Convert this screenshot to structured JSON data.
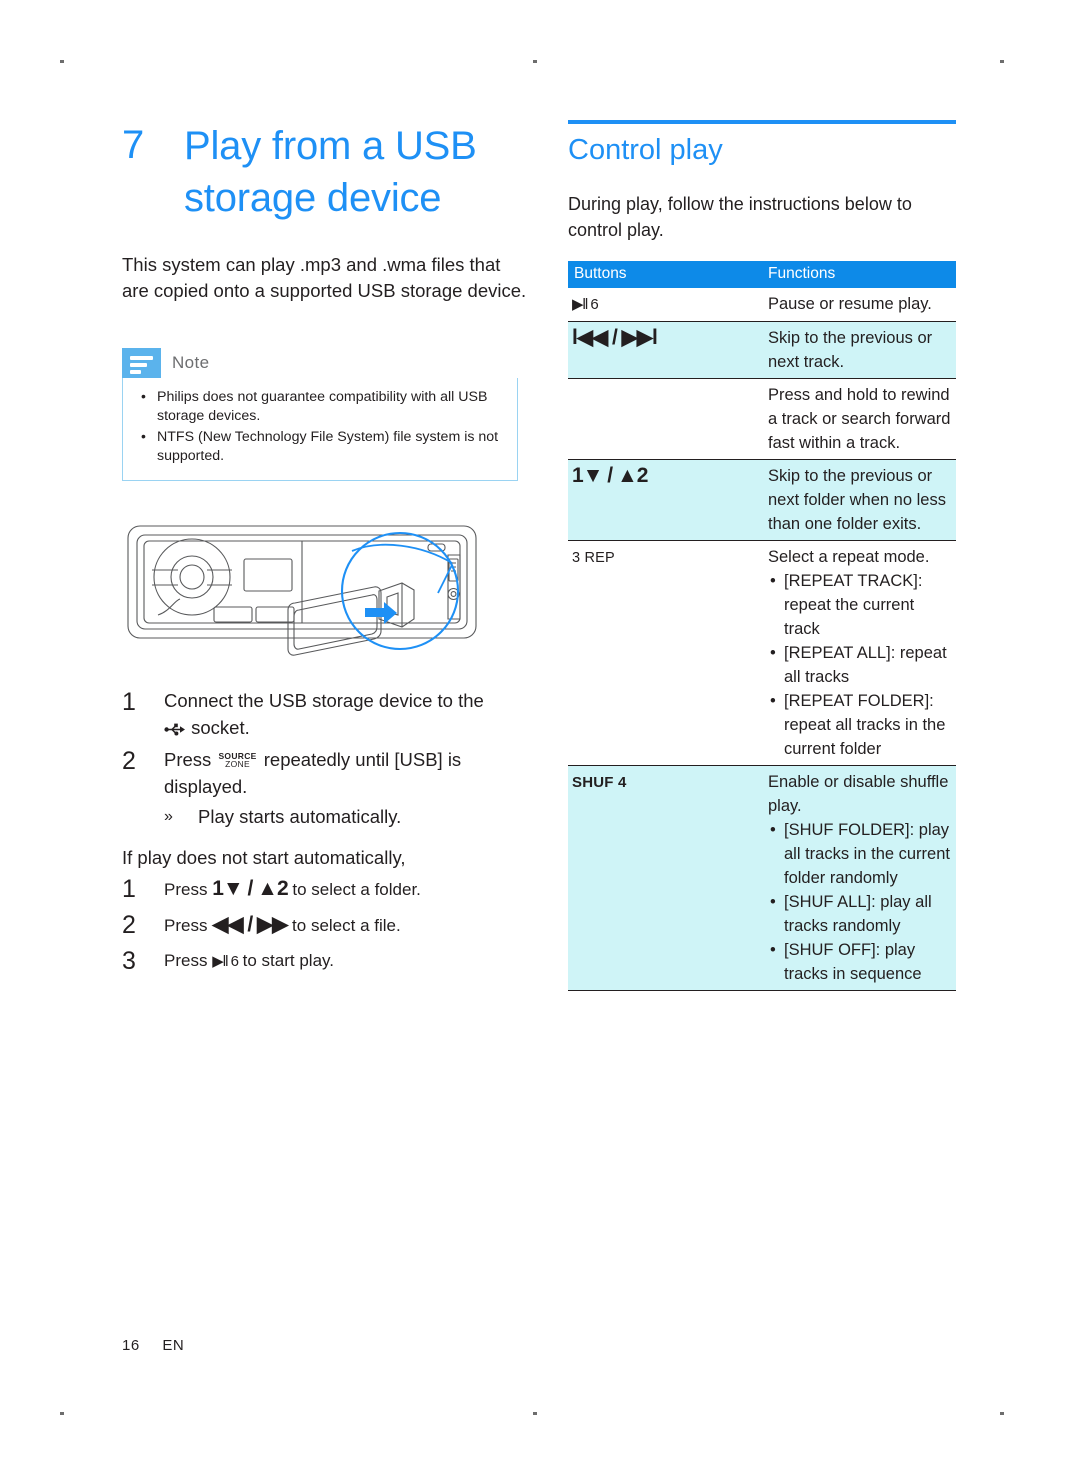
{
  "page": {
    "footer_page": "16",
    "footer_lang": "EN"
  },
  "colors": {
    "heading_blue": "#1e90f5",
    "table_header_blue": "#0d8ae8",
    "table_row_cyan": "#cff4f7",
    "note_icon_blue": "#5bb3ec",
    "note_border_blue": "#9ad3f2",
    "text": "#231f20"
  },
  "chapter": {
    "number": "7",
    "title_line1": "Play from a USB",
    "title_line2": "storage device",
    "intro": "This system can play .mp3 and .wma files that are copied onto a supported USB storage device."
  },
  "note": {
    "label": "Note",
    "icon": "note-lines-icon",
    "items": [
      "Philips does not guarantee compatibility with all USB storage devices.",
      "NTFS (New Technology File System) file system is not supported."
    ]
  },
  "illustration": {
    "name": "car-stereo-usb-insert-illustration",
    "caption": ""
  },
  "steps": {
    "items": [
      {
        "number": "1",
        "text_before": "Connect the USB storage device to the",
        "icon": "usb-trident-icon",
        "text_after": "socket."
      },
      {
        "number": "2",
        "text_before": "Press",
        "button_top": "SOURCE",
        "button_bottom": "ZONE",
        "text_after": "repeatedly until [USB] is displayed."
      }
    ],
    "sub_note": {
      "glyph": "»",
      "text": "Play starts automatically."
    }
  },
  "fallback": {
    "condition": "If play does not start automatically,",
    "items": [
      {
        "number": "1",
        "press": "Press",
        "glyphs": "1▼ / ▲2",
        "tail": "to select a folder."
      },
      {
        "number": "2",
        "press": "Press",
        "glyphs": "◀◀ / ▶▶",
        "tail": "to select a file."
      },
      {
        "number": "3",
        "press": "Press",
        "glyphs": "▶ll 6",
        "tail": "to start play."
      }
    ]
  },
  "control": {
    "heading": "Control play",
    "intro": "During play, follow the instructions below to control play.",
    "table": {
      "headers": [
        "Buttons",
        "Functions"
      ],
      "rows": [
        {
          "button": "▶ll 6",
          "button_kind": "playpause",
          "function": "Pause or resume play.",
          "bullets": [],
          "shaded": false
        },
        {
          "button": "l◀◀ / ▶▶l",
          "button_kind": "prevnext",
          "function": "Skip to the previous or next track.",
          "bullets": [],
          "shaded": true
        },
        {
          "button": "",
          "button_kind": "none",
          "function": "Press and hold to rewind a track or search forward fast within a track.",
          "bullets": [],
          "shaded": false
        },
        {
          "button": "1▼ / ▲2",
          "button_kind": "folder",
          "function": "Skip to the previous or next folder when no less than one folder exits.",
          "bullets": [],
          "shaded": true
        },
        {
          "button": "3 REP",
          "button_kind": "rep",
          "function": "Select a repeat mode.",
          "bullets": [
            "[REPEAT TRACK]: repeat the current track",
            "[REPEAT ALL]: repeat all tracks",
            "[REPEAT FOLDER]: repeat all tracks in the current folder"
          ],
          "shaded": false
        },
        {
          "button": "SHUF 4",
          "button_kind": "shuf",
          "function": "Enable or disable shuffle play.",
          "bullets": [
            "[SHUF FOLDER]: play all tracks in the current folder randomly",
            "[SHUF ALL]: play all tracks randomly",
            "[SHUF OFF]: play tracks in sequence"
          ],
          "shaded": true
        }
      ]
    }
  }
}
